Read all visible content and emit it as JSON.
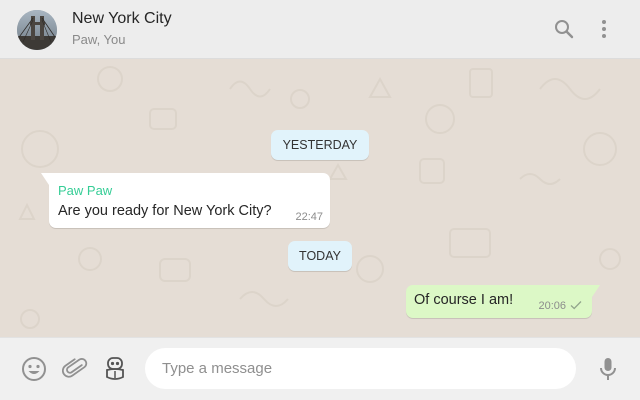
{
  "header": {
    "title": "New York City",
    "subtitle": "Paw, You",
    "avatar_icon": "brooklyn-bridge-photo",
    "search_icon": "search-icon",
    "menu_icon": "more-vertical-icon"
  },
  "chat": {
    "date_dividers": [
      "YESTERDAY",
      "TODAY"
    ],
    "messages": [
      {
        "direction": "incoming",
        "sender": "Paw Paw",
        "text": "Are you ready for New York City?",
        "time": "22:47"
      },
      {
        "direction": "outgoing",
        "text": "Of course I am!",
        "time": "20:06",
        "status_icon": "single-check-icon"
      }
    ]
  },
  "composer": {
    "placeholder": "Type a message",
    "value": "",
    "emoji_icon": "emoji-icon",
    "attach_icon": "paperclip-icon",
    "bot_icon": "robot-icon",
    "mic_icon": "microphone-icon"
  },
  "colors": {
    "header_bg": "#ededed",
    "chat_bg": "#e5ddd5",
    "incoming_bubble": "#ffffff",
    "outgoing_bubble": "#dcf8c6",
    "date_pill": "#e1f3fb",
    "sender_name": "#35cd96",
    "icon_gray": "#919191"
  }
}
